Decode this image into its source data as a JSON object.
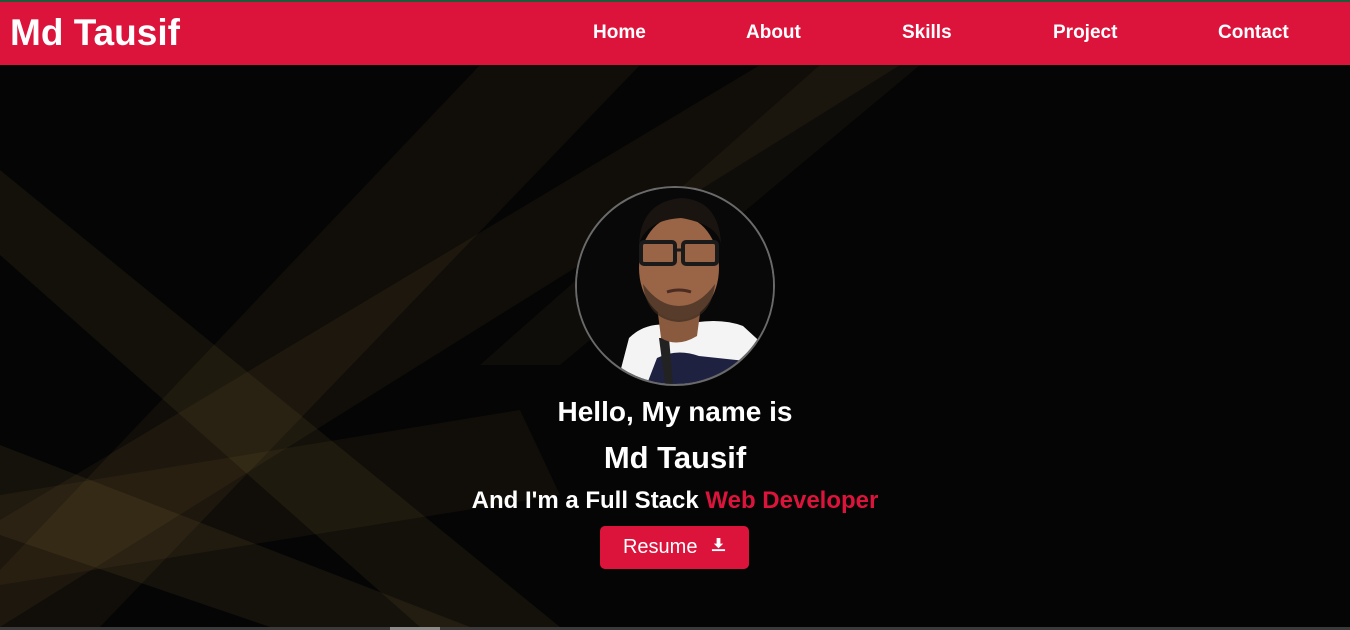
{
  "navbar": {
    "brand": "Md Tausif",
    "links": [
      {
        "label": "Home"
      },
      {
        "label": "About"
      },
      {
        "label": "Skills"
      },
      {
        "label": "Project"
      },
      {
        "label": "Contact"
      }
    ]
  },
  "hero": {
    "greeting": "Hello, My name is",
    "name": "Md Tausif",
    "role_prefix": "And I'm a Full Stack",
    "role_highlight": "Web Developer",
    "resume_label": "Resume",
    "resume_icon": "download-icon",
    "avatar_icon": "profile-photo"
  },
  "colors": {
    "accent": "#dc143c",
    "background": "#050505",
    "text": "#ffffff"
  }
}
